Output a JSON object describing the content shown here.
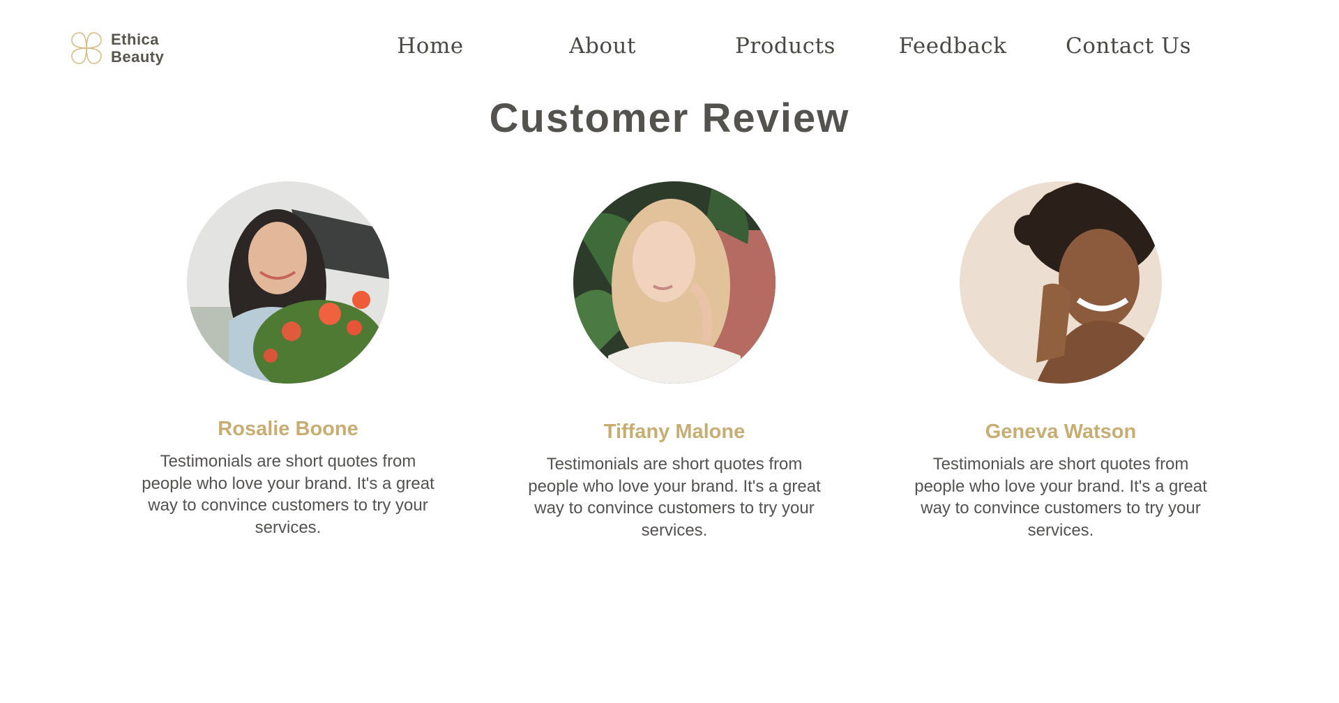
{
  "brand": {
    "line1": "Ethica",
    "line2": "Beauty",
    "logo_icon": "four-petal-flower-icon",
    "logo_color": "#d4bb85"
  },
  "nav": {
    "items": [
      {
        "label": "Home"
      },
      {
        "label": "About"
      },
      {
        "label": "Products"
      },
      {
        "label": "Feedback"
      },
      {
        "label": "Contact Us"
      }
    ]
  },
  "main": {
    "title": "Customer Review",
    "reviews": [
      {
        "name": "Rosalie Boone",
        "text": "Testimonials are short quotes from people who love your brand. It's a great way to convince customers to try your services."
      },
      {
        "name": "Tiffany Malone",
        "text": "Testimonials are short quotes from people who love your brand. It's a great way to convince customers to try your services."
      },
      {
        "name": "Geneva Watson",
        "text": "Testimonials are short quotes from people who love your brand. It's a great way to convince customers to try your services."
      }
    ]
  },
  "colors": {
    "accent": "#c8ad72",
    "text": "#545250",
    "background": "#ffffff"
  }
}
